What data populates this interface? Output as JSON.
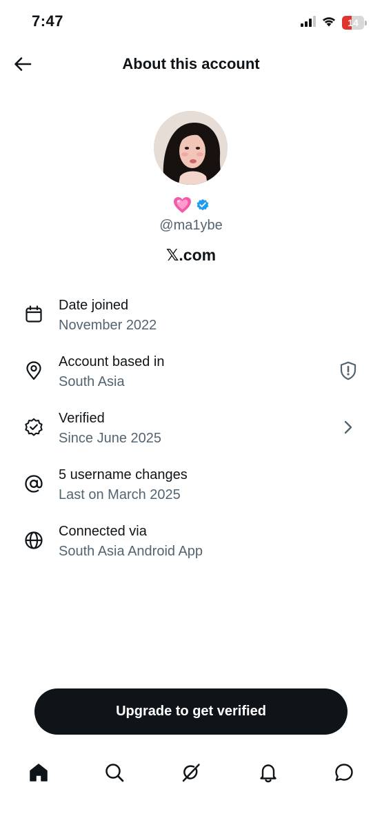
{
  "status_bar": {
    "time": "7:47",
    "battery_level": "14",
    "battery_fraction": 0.14,
    "battery_color": "#e0342f"
  },
  "header": {
    "title": "About this account"
  },
  "profile": {
    "name_emoji": "💗",
    "handle": "@ma1ybe",
    "domain_x": "𝕏",
    "domain_rest": ".com",
    "verified_color": "#1d9bf0"
  },
  "info": [
    {
      "icon": "calendar-icon",
      "title": "Date joined",
      "subtitle": "November 2022"
    },
    {
      "icon": "location-pin-icon",
      "title": "Account based in",
      "subtitle": "South Asia",
      "trailing": "shield-alert-icon"
    },
    {
      "icon": "verified-badge-icon",
      "title": "Verified",
      "subtitle": "Since June 2025",
      "trailing": "chevron-right-icon"
    },
    {
      "icon": "at-sign-icon",
      "title": "5 username changes",
      "subtitle": "Last on March 2025"
    },
    {
      "icon": "globe-icon",
      "title": "Connected via",
      "subtitle": "South Asia Android App"
    }
  ],
  "upgrade": {
    "label": "Upgrade to get verified"
  },
  "bottom_nav": [
    {
      "icon": "home-icon",
      "active": true
    },
    {
      "icon": "search-icon",
      "active": false
    },
    {
      "icon": "grok-icon",
      "active": false
    },
    {
      "icon": "bell-icon",
      "active": false
    },
    {
      "icon": "messages-icon",
      "active": false
    }
  ],
  "colors": {
    "text": "#0f1419",
    "secondary_text": "#536471",
    "button_bg": "#0f1419"
  }
}
